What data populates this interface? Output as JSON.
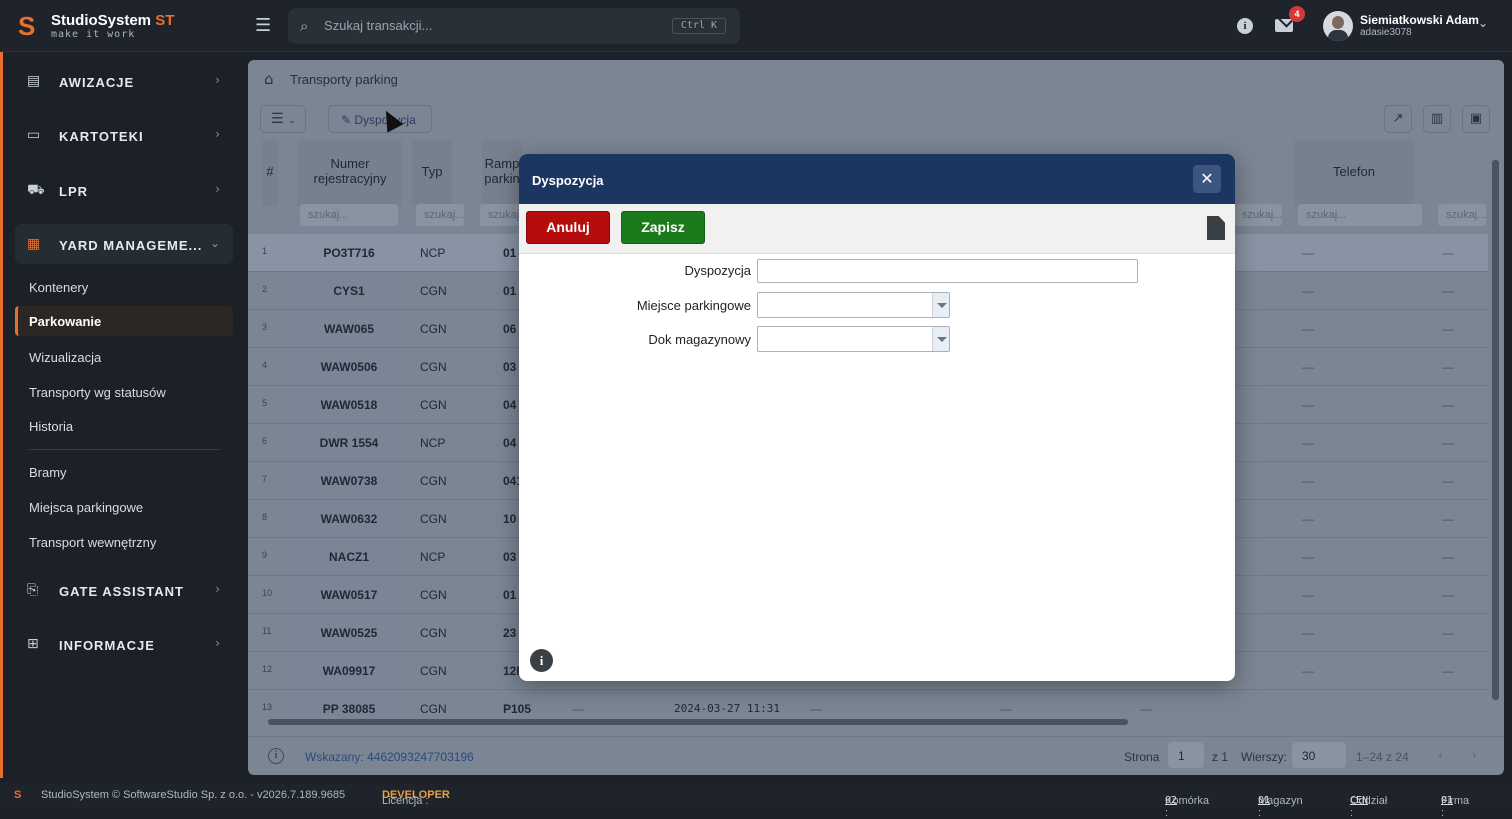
{
  "app": {
    "brand": "StudioSystem",
    "brand_suffix": "ST",
    "tagline": "make it work"
  },
  "search": {
    "placeholder": "Szukaj transakcji...",
    "shortcut": "Ctrl K"
  },
  "header": {
    "mail_count": "4",
    "user_name": "Siemiatkowski Adam",
    "user_login": "adasie3078"
  },
  "sidebar": {
    "groups": [
      {
        "label": "AWIZACJE",
        "icon": "clipboard-icon"
      },
      {
        "label": "KARTOTEKI",
        "icon": "folder-icon"
      },
      {
        "label": "LPR",
        "icon": "truck-icon"
      },
      {
        "label": "YARD MANAGEME...",
        "icon": "grid-icon"
      },
      {
        "label": "GATE ASSISTANT",
        "icon": "assistant-icon"
      },
      {
        "label": "INFORMACJE",
        "icon": "sitemap-icon"
      }
    ],
    "items": [
      "Kontenery",
      "Parkowanie",
      "Wizualizacja",
      "Transporty wg statusów",
      "Historia",
      "Bramy",
      "Miejsca parkingowe",
      "Transport wewnętrzny"
    ]
  },
  "breadcrumb": {
    "title": "Transporty parking"
  },
  "toolbar": {
    "disp_label": "Dyspozycja"
  },
  "grid": {
    "headers": {
      "num": "Numer rejestracyjny",
      "typ": "Typ",
      "ramp": "Ramp parkin",
      "tel": "Telefon"
    },
    "filter_ph": "szukaj...",
    "rows": [
      {
        "n": "1",
        "reg": "PO3T716",
        "typ": "NCP",
        "ramp": "01"
      },
      {
        "n": "2",
        "reg": "CYS1",
        "typ": "CGN",
        "ramp": "01"
      },
      {
        "n": "3",
        "reg": "WAW065",
        "typ": "CGN",
        "ramp": "06"
      },
      {
        "n": "4",
        "reg": "WAW0506",
        "typ": "CGN",
        "ramp": "03"
      },
      {
        "n": "5",
        "reg": "WAW0518",
        "typ": "CGN",
        "ramp": "04"
      },
      {
        "n": "6",
        "reg": "DWR 1554",
        "typ": "NCP",
        "ramp": "04"
      },
      {
        "n": "7",
        "reg": "WAW0738",
        "typ": "CGN",
        "ramp": "041"
      },
      {
        "n": "8",
        "reg": "WAW0632",
        "typ": "CGN",
        "ramp": "10"
      },
      {
        "n": "9",
        "reg": "NACZ1",
        "typ": "NCP",
        "ramp": "03"
      },
      {
        "n": "10",
        "reg": "WAW0517",
        "typ": "CGN",
        "ramp": "01"
      },
      {
        "n": "11",
        "reg": "WAW0525",
        "typ": "CGN",
        "ramp": "23"
      },
      {
        "n": "12",
        "reg": "WA09917",
        "typ": "CGN",
        "ramp": "12R"
      },
      {
        "n": "13",
        "reg": "PP 38085",
        "typ": "CGN",
        "ramp": "P105",
        "date": "2024-03-27 11:31"
      }
    ],
    "dash": "—"
  },
  "footer": {
    "selected": "Wskazany: 4462093247703196",
    "page_label": "Strona",
    "page": "1",
    "of": "z 1",
    "rows_label": "Wierszy:",
    "rows": "30",
    "range": "1–24 z 24"
  },
  "modal": {
    "title": "Dyspozycja",
    "cancel": "Anuluj",
    "save": "Zapisz",
    "fields": {
      "disp": "Dyspozycja",
      "place": "Miejsce parkingowe",
      "dock": "Dok magazynowy"
    }
  },
  "status": {
    "copyright": "StudioSystem © SoftwareStudio Sp. z o.o. - v2026.7.189.9685",
    "license_label": "Licencja :",
    "license": "DEVELOPER",
    "cell_label": "Komórka :",
    "cell": "02",
    "mag_label": "Magazyn :",
    "mag": "01",
    "dept_label": "Oddział :",
    "dept": "CEN",
    "firm_label": "Firma :",
    "firm": "01"
  }
}
